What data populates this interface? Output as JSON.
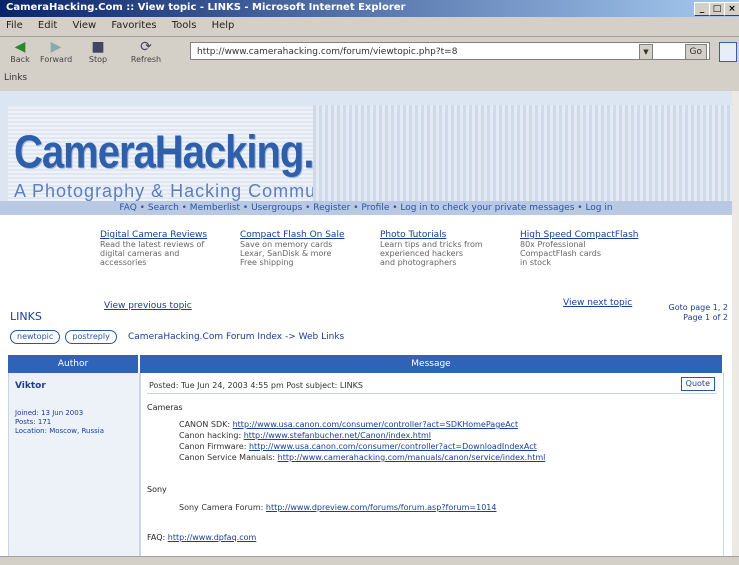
{
  "window": {
    "title": "CameraHacking.Com :: View topic - LINKS - Microsoft Internet Explorer"
  },
  "menu": [
    "File",
    "Edit",
    "View",
    "Favorites",
    "Tools",
    "Help"
  ],
  "toolbar": {
    "back": "Back",
    "forward": "Forward",
    "stop": "Stop",
    "refresh": "Refresh",
    "go": "Go",
    "links": "Links"
  },
  "address": {
    "url": "http://www.camerahacking.com/forum/viewtopic.php?t=8"
  },
  "header": {
    "logo": "CameraHacking.Com",
    "tagline": "A Photography & Hacking Community"
  },
  "nav": "FAQ • Search • Memberlist • Usergroups • Register • Profile • Log in to check your private messages • Log in",
  "promos": [
    {
      "title": "Digital Camera Reviews",
      "lines": [
        "Read the latest reviews of",
        "digital cameras and",
        "accessories"
      ]
    },
    {
      "title": "Compact Flash On Sale",
      "lines": [
        "Save on memory cards",
        "Lexar, SanDisk & more",
        "Free shipping"
      ]
    },
    {
      "title": "Photo Tutorials",
      "lines": [
        "Learn tips and tricks from",
        "experienced hackers",
        "and photographers"
      ]
    },
    {
      "title": "High Speed CompactFlash",
      "lines": [
        "80x Professional",
        "CompactFlash cards",
        "in stock"
      ]
    }
  ],
  "links_left": "View previous topic",
  "links_right": "View next topic",
  "right_mini": [
    "Goto page 1, 2",
    "Page 1 of 2"
  ],
  "topic_title": "LINKS",
  "buttons": {
    "new_topic": "newtopic",
    "post_reply": "postreply"
  },
  "breadcrumb": "CameraHacking.Com Forum Index -> Web Links",
  "table": {
    "col_author": "Author",
    "col_message": "Message"
  },
  "post": {
    "author": "Viktor",
    "meta": [
      "Joined: 13 Jun 2003",
      "Posts: 171",
      "Location: Moscow, Russia"
    ],
    "subject": "Posted: Tue Jun 24, 2003 4:55 pm    Post subject: LINKS",
    "quote": "Quote",
    "section1": "Cameras",
    "links1": [
      {
        "label": "CANON SDK:",
        "url": "http://www.usa.canon.com/consumer/controller?act=SDKHomePageAct"
      },
      {
        "label": "Canon hacking:",
        "url": "http://www.stefanbucher.net/Canon/index.html"
      },
      {
        "label": "Canon Firmware:",
        "url": "http://www.usa.canon.com/consumer/controller?act=DownloadIndexAct"
      },
      {
        "label": "Canon Service Manuals:",
        "url": "http://www.camerahacking.com/manuals/canon/service/index.html"
      }
    ],
    "section2": "Sony",
    "links2": [
      {
        "label": "Sony Camera Forum:",
        "url": "http://www.dpreview.com/forums/forum.asp?forum=1014"
      }
    ],
    "faq_label": "FAQ:",
    "faq_url": "http://www.dpfaq.com"
  }
}
